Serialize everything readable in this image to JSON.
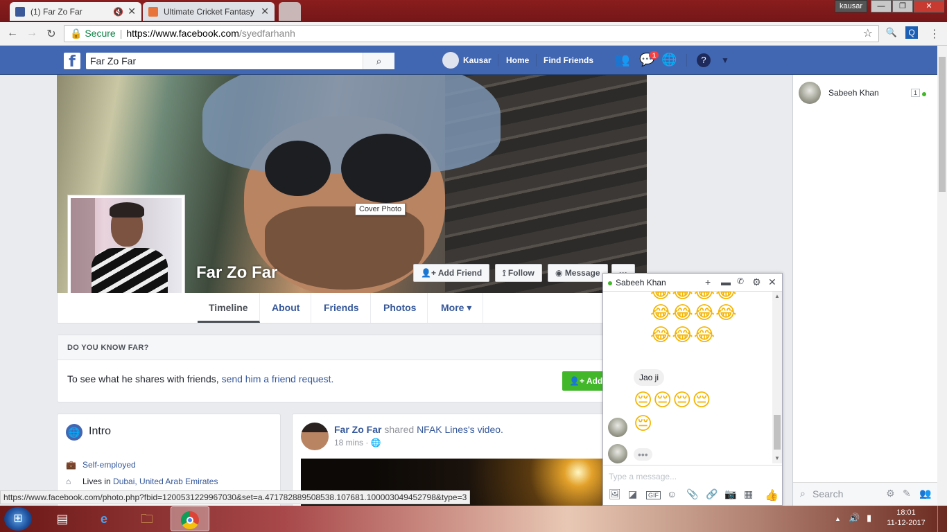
{
  "browser": {
    "tabs": [
      {
        "label": "(1) Far Zo Far",
        "favicon_color": "#3b5998"
      },
      {
        "label": "Ultimate Cricket Fantasy",
        "favicon_color": "#e8743b"
      }
    ],
    "window_user": "kausar",
    "secure_label": "Secure",
    "url_host": "https://www.facebook.com",
    "url_path": "/syedfarhanh",
    "status_url": "https://www.facebook.com/photo.php?fbid=1200531229967030&set=a.471782889508538.107681.100003049452798&type=3"
  },
  "fb_header": {
    "logo": "f",
    "search_value": "Far Zo Far",
    "user_name": "Kausar",
    "home": "Home",
    "find_friends": "Find Friends",
    "messages_badge": "1"
  },
  "profile": {
    "name": "Far Zo Far",
    "cover_tooltip": "Cover Photo",
    "buttons": {
      "add_friend": "Add Friend",
      "follow": "Follow",
      "message": "Message",
      "more": "···"
    },
    "tabs": [
      "Timeline",
      "About",
      "Friends",
      "Photos",
      "More ▾"
    ]
  },
  "know_box": {
    "heading": "DO YOU KNOW FAR?",
    "text": "To see what he shares with friends,",
    "link": "send him a friend request.",
    "button": "Add"
  },
  "intro": {
    "title": "Intro",
    "rows": [
      {
        "icon": "briefcase-icon",
        "text": "Self-employed"
      },
      {
        "icon": "home-icon",
        "prefix": "Lives in ",
        "text": "Dubai, United Arab Emirates"
      }
    ]
  },
  "post": {
    "author": "Far Zo Far",
    "action": " shared ",
    "target": "NFAK Lines",
    "suffix": "'s video.",
    "time": "18 mins"
  },
  "chat_sidebar": {
    "contact_name": "Sabeeh Khan",
    "contact_badge": "1",
    "search_label": "Search"
  },
  "chat_window": {
    "name": "Sabeeh Khan",
    "message": "Jao ji",
    "input_placeholder": "Type a message...",
    "emoji_laugh_row1": "😂😂😂😂",
    "emoji_laugh_row2": "😂😂😂",
    "emoji_sad_row1": "😔😔😔😔",
    "emoji_sad_row2": "😔",
    "typing": "•••"
  },
  "taskbar": {
    "time": "18:01",
    "date": "11-12-2017"
  },
  "colors": {
    "fb_blue": "#4267b2",
    "link": "#365899",
    "green": "#42b72a"
  }
}
